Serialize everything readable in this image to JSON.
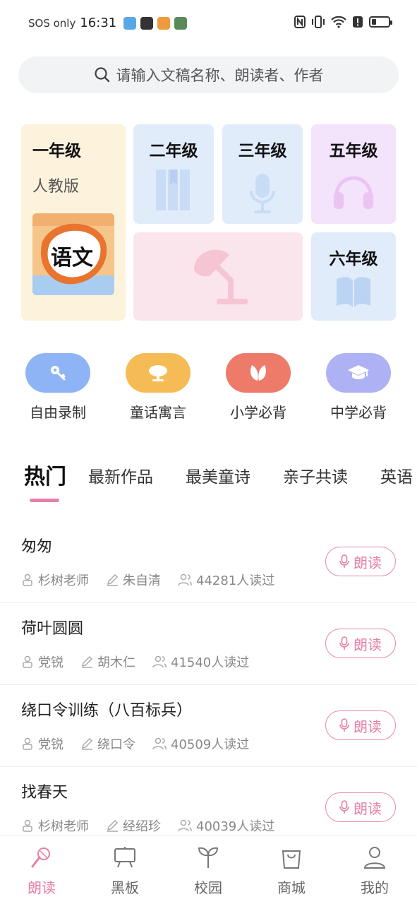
{
  "status_bar": {
    "carrier": "SOS only",
    "time": "16:31"
  },
  "search": {
    "placeholder": "请输入文稿名称、朗读者、作者"
  },
  "grades": {
    "g1": {
      "title": "一年级",
      "subtitle": "人教版",
      "book_text": "语文"
    },
    "g2": {
      "title": "二年级"
    },
    "g3": {
      "title": "三年级"
    },
    "g5": {
      "title": "五年级"
    },
    "g6": {
      "title": "六年级"
    }
  },
  "categories": [
    {
      "label": "自由录制",
      "color": "#8fb4f5",
      "icon": "key-icon"
    },
    {
      "label": "童话寓言",
      "color": "#f5bb55",
      "icon": "tree-icon"
    },
    {
      "label": "小学必背",
      "color": "#ee7a6a",
      "icon": "leaf-icon"
    },
    {
      "label": "中学必背",
      "color": "#aeb2f5",
      "icon": "graduation-cap-icon"
    }
  ],
  "tabs": [
    "热门",
    "最新作品",
    "最美童诗",
    "亲子共读",
    "英语"
  ],
  "list": [
    {
      "title": "匆匆",
      "reader": "杉树老师",
      "author": "朱自清",
      "reads": "44281人读过",
      "button": "朗读"
    },
    {
      "title": "荷叶圆圆",
      "reader": "党锐",
      "author": "胡木仁",
      "reads": "41540人读过",
      "button": "朗读"
    },
    {
      "title": "绕口令训练（八百标兵）",
      "reader": "党锐",
      "author": "绕口令",
      "reads": "40509人读过",
      "button": "朗读"
    },
    {
      "title": "找春天",
      "reader": "杉树老师",
      "author": "经绍珍",
      "reads": "40039人读过",
      "button": "朗读"
    }
  ],
  "nav": [
    "朗读",
    "黑板",
    "校园",
    "商城",
    "我的"
  ],
  "colors": {
    "accent": "#e77fa6"
  }
}
